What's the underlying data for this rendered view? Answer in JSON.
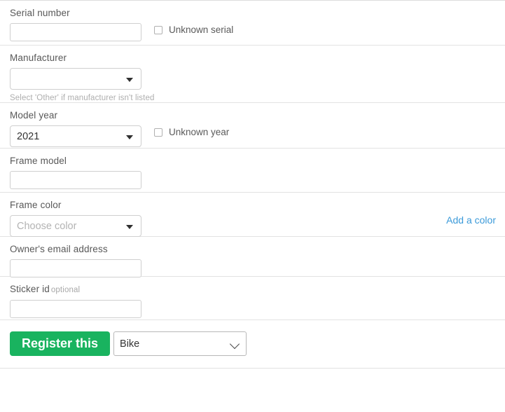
{
  "form": {
    "fields": [
      {
        "key": "serial_number",
        "label": "Serial number",
        "value": "",
        "checkbox_label": "Unknown serial"
      },
      {
        "key": "manufacturer",
        "label": "Manufacturer",
        "value": "",
        "hint": "Select 'Other' if manufacturer isn't listed"
      },
      {
        "key": "model_year",
        "label": "Model year",
        "value": "2021",
        "checkbox_label": "Unknown year"
      },
      {
        "key": "frame_model",
        "label": "Frame model",
        "value": ""
      },
      {
        "key": "frame_color",
        "label": "Frame color",
        "placeholder": "Choose color",
        "link_label": "Add a color"
      },
      {
        "key": "owner_email",
        "label": "Owner's email address",
        "value": ""
      },
      {
        "key": "sticker_id",
        "label": "Sticker id",
        "optional_tag": "optional",
        "value": ""
      }
    ],
    "submit": {
      "button_label": "Register this",
      "type_selected": "Bike",
      "type_options": [
        "Bike"
      ]
    }
  },
  "colors": {
    "primary_button": "#19b35f",
    "link": "#3b9ad9",
    "label_text": "#585858",
    "hint_text": "#aeaeae",
    "border": "#e2e2e2",
    "input_border": "#cfcfcf"
  }
}
